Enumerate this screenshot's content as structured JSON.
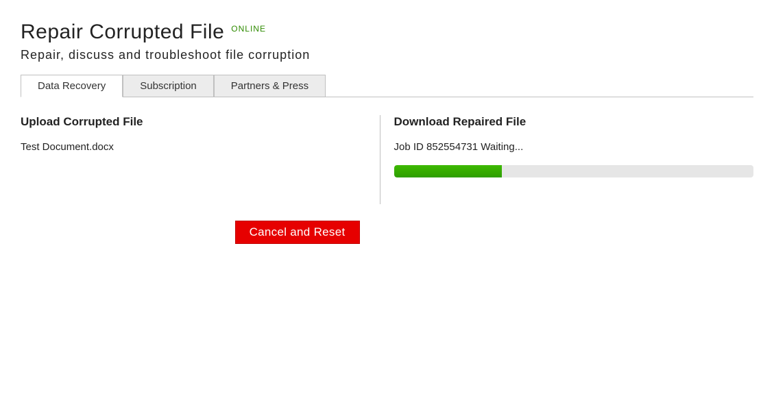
{
  "header": {
    "title": "Repair Corrupted File",
    "badge": "ONLINE",
    "subtitle": "Repair, discuss and troubleshoot file corruption"
  },
  "tabs": {
    "data_recovery": "Data Recovery",
    "subscription": "Subscription",
    "partners_press": "Partners & Press"
  },
  "left": {
    "heading": "Upload Corrupted File",
    "file_name": "Test Document.docx",
    "cancel_label": "Cancel and Reset"
  },
  "right": {
    "heading": "Download Repaired File",
    "job_status": "Job ID 852554731 Waiting...",
    "progress_percent": "30"
  }
}
